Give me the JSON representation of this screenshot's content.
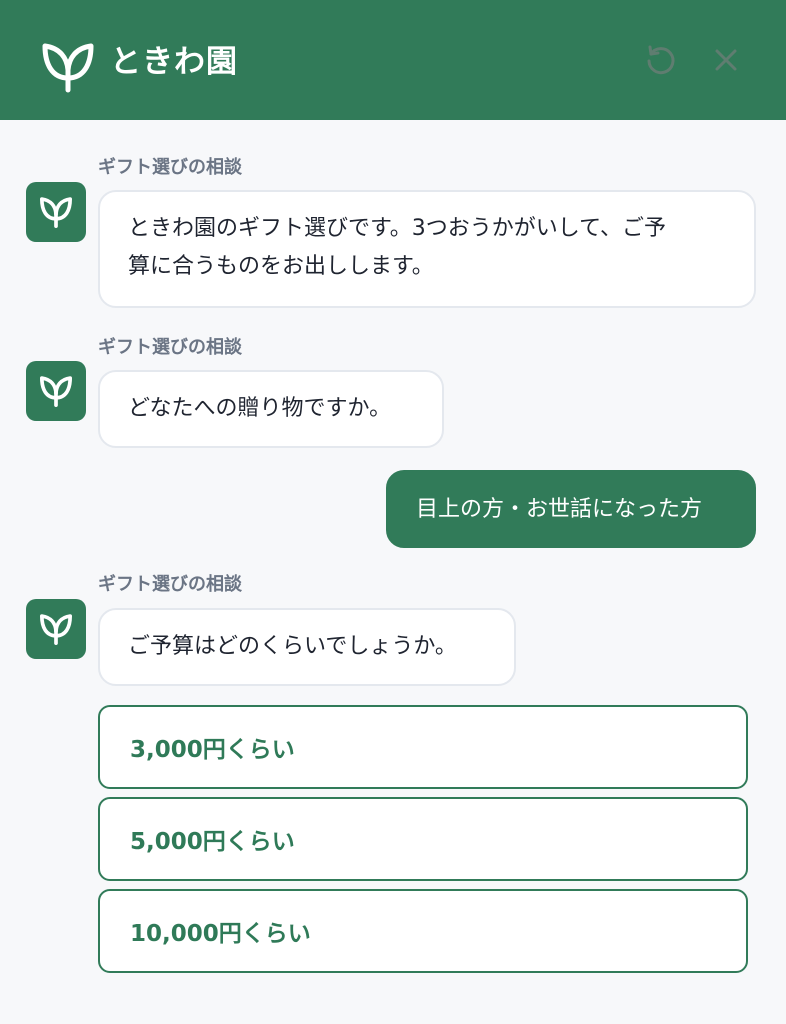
{
  "header": {
    "title": "ときわ園",
    "brand_color": "#317b59",
    "logo_icon": "leaf-sprout-icon",
    "reset_icon": "refresh-icon",
    "close_icon": "close-icon"
  },
  "messages": [
    {
      "sender": "ギフト選びの相談",
      "text": "ときわ園のギフト選びです。3つおうかがいして、ご予算に合うものをお出しします。",
      "line1": "ときわ園のギフト選びです。3つおうかがいして、ご予",
      "line2": "算に合うものをお出しします。"
    },
    {
      "sender": "ギフト選びの相談",
      "text": "どなたへの贈り物ですか。"
    },
    {
      "sender": "user",
      "text": "目上の方・お世話になった方"
    },
    {
      "sender": "ギフト選びの相談",
      "text": "ご予算はどのくらいでしょうか。"
    }
  ],
  "options": [
    {
      "label": "3,000円くらい"
    },
    {
      "label": "5,000円くらい"
    },
    {
      "label": "10,000円くらい"
    }
  ]
}
